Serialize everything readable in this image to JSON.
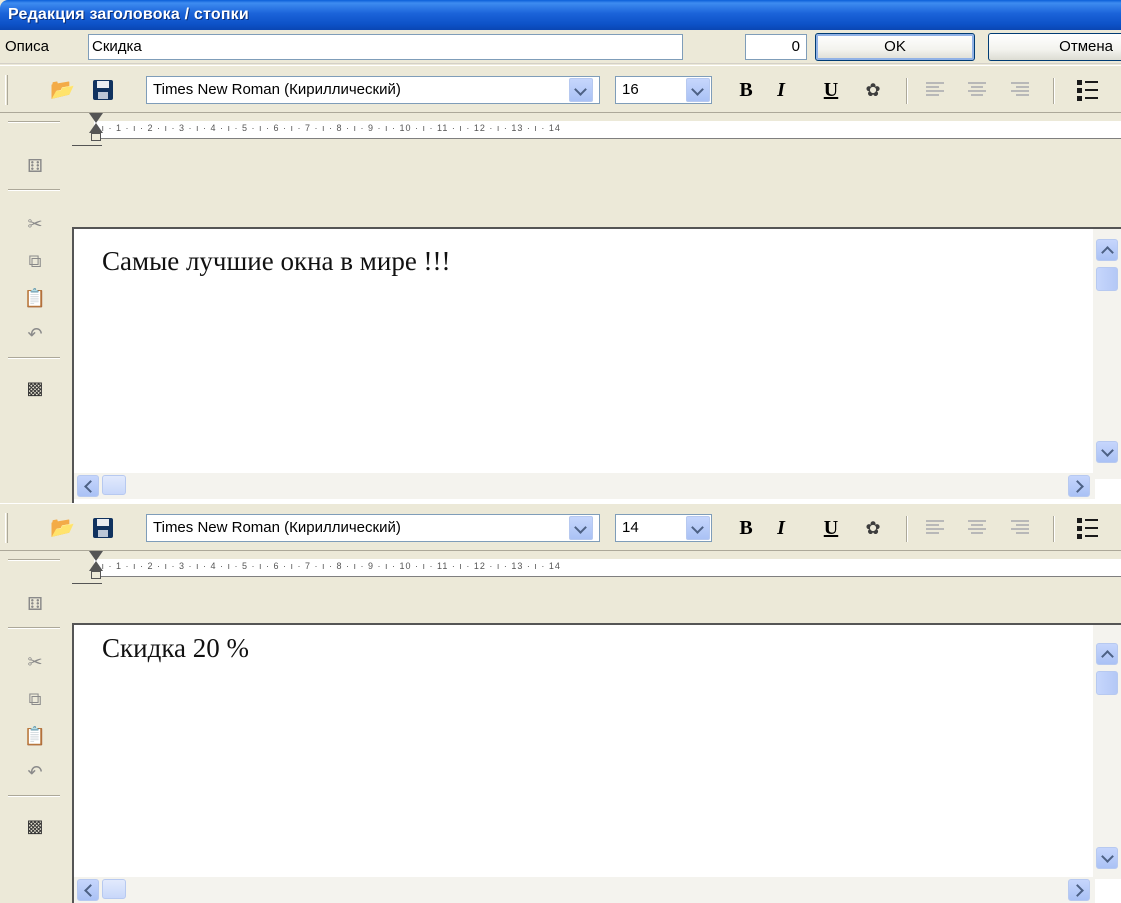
{
  "window": {
    "title": "Редакция заголовока / стопки"
  },
  "header": {
    "description_label": "Описа",
    "description_value": "Скидка",
    "number_value": "0",
    "ok_label": "OK",
    "cancel_label": "Отмена"
  },
  "editors": [
    {
      "font_name": "Times New Roman (Кирилличеcкий)",
      "font_size": "16",
      "text": "Самые лучшие окна в мире !!!",
      "ruler": "· ı · 1 · ı · 2 · ı · 3 · ı · 4 · ı · 5 · ı · 6 · ı · 7 · ı · 8 · ı · 9 · ı · 10 · ı · 11 · ı · 12 · ı · 13 · ı · 14"
    },
    {
      "font_name": "Times New Roman (Кирилличеcкий)",
      "font_size": "14",
      "text": "Скидка 20 %",
      "ruler": "· ı · 1 · ı · 2 · ı · 3 · ı · 4 · ı · 5 · ı · 6 · ı · 7 · ı · 8 · ı · 9 · ı · 10 · ı · 11 · ı · 12 · ı · 13 · ı · 14"
    }
  ],
  "format_buttons": {
    "bold": "B",
    "italic": "I",
    "underline": "U"
  },
  "icons": {
    "open": "open-folder-icon",
    "save": "save-disk-icon",
    "find": "binoculars-icon",
    "cut": "scissors-icon",
    "copy": "copy-icon",
    "paste": "paste-icon",
    "undo": "undo-icon",
    "insert": "insert-field-icon",
    "color": "font-color-icon",
    "list": "bullet-list-icon"
  },
  "colors": {
    "title_bar": "#0d52c8",
    "scrollbar": "#aac2f5",
    "face": "#ece9d8"
  }
}
